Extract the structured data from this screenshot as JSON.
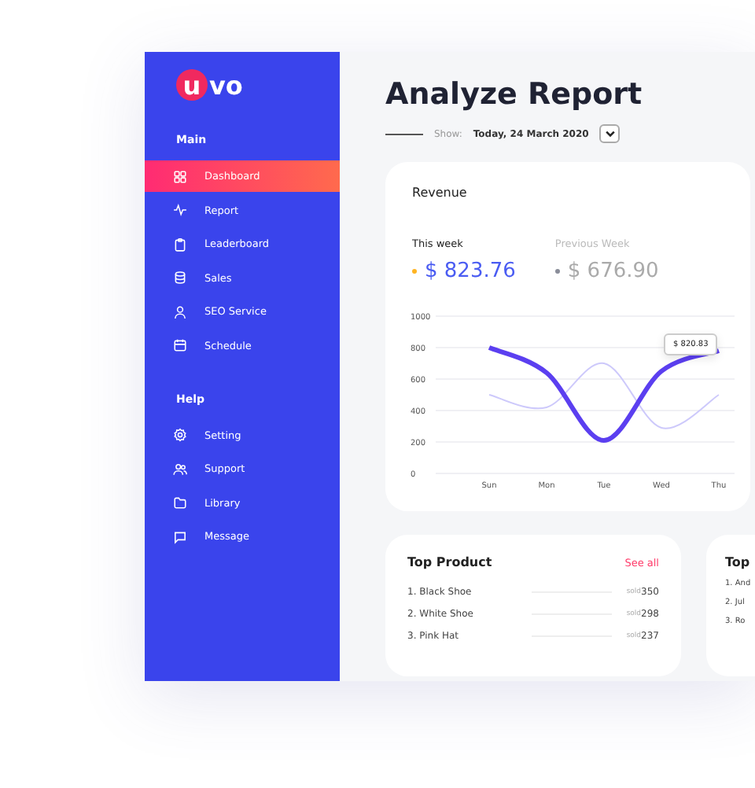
{
  "logo": {
    "text": "vo",
    "badge": "u"
  },
  "sidebar": {
    "sections": [
      {
        "title": "Main",
        "items": [
          {
            "label": "Dashboard",
            "selected": true
          },
          {
            "label": "Report",
            "selected": false
          },
          {
            "label": "Leaderboard",
            "selected": false
          },
          {
            "label": "Sales",
            "selected": false
          },
          {
            "label": "SEO Service",
            "selected": false
          },
          {
            "label": "Schedule",
            "selected": false
          }
        ]
      },
      {
        "title": "Help",
        "items": [
          {
            "label": "Setting",
            "selected": false
          },
          {
            "label": "Support",
            "selected": false
          },
          {
            "label": "Library",
            "selected": false
          },
          {
            "label": "Message",
            "selected": false
          }
        ]
      }
    ]
  },
  "header": {
    "title": "Analyze Report",
    "show_label": "Show:",
    "date": "Today, 24 March 2020"
  },
  "revenue": {
    "title": "Revenue",
    "legend": [
      {
        "label": "This week",
        "value": "$ 823.76",
        "color": "#ffb422",
        "selected": true
      },
      {
        "label": "Previous Week",
        "value": "$ 676.90",
        "color": "#8a8d99",
        "selected": false
      }
    ],
    "chart_data": {
      "type": "line",
      "categories": [
        "Sun",
        "Mon",
        "Tue",
        "Wed",
        "Thu"
      ],
      "series": [
        {
          "color": "#5b3ff0",
          "values": [
            800,
            640,
            210,
            650,
            780
          ]
        },
        {
          "color": "#cdc9fb",
          "values": [
            500,
            420,
            700,
            290,
            500
          ]
        }
      ],
      "ylim": [
        0,
        1000
      ],
      "grid": true,
      "yticks": [
        0,
        200,
        400,
        600,
        800,
        1000
      ],
      "annotations": [
        {
          "text": "$ 820.83"
        }
      ]
    }
  },
  "top_product": {
    "title": "Top Product",
    "link": "See all",
    "rows": [
      {
        "name": "1. Black Shoe",
        "sold": "sold",
        "count": "350"
      },
      {
        "name": "2. White Shoe",
        "sold": "sold",
        "count": "298"
      },
      {
        "name": "3. Pink Hat",
        "sold": "sold",
        "count": "237"
      }
    ]
  },
  "second_card": {
    "title": "Top",
    "rows": [
      "1. And",
      "2. Jul",
      "3. Ro"
    ]
  }
}
